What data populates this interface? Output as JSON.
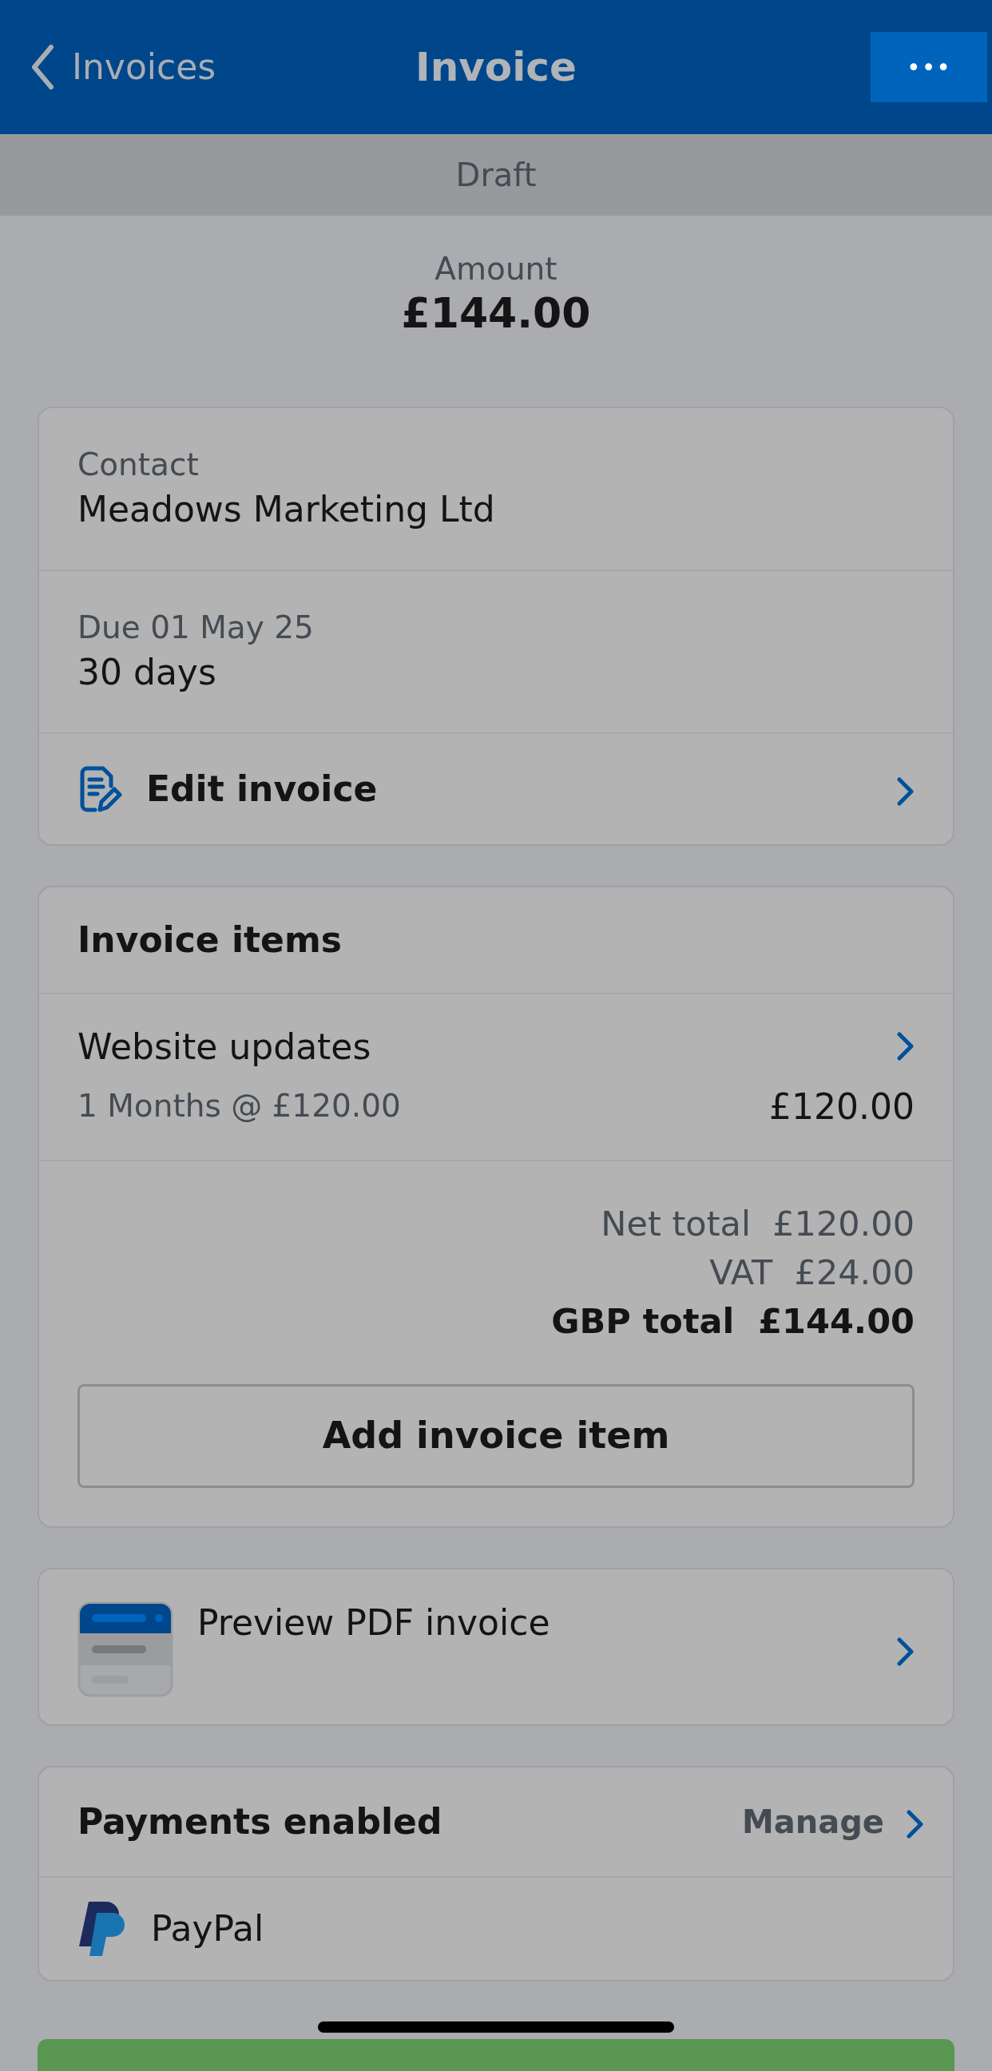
{
  "nav": {
    "back": "Invoices",
    "title": "Invoice",
    "more": "•••"
  },
  "status": "Draft",
  "amount": {
    "label": "Amount",
    "value": "£144.00"
  },
  "details": [
    {
      "label": "Contact",
      "value": "Meadows Marketing Ltd"
    },
    {
      "label": "Due 01 May 25",
      "value": "30 days"
    }
  ],
  "edit": {
    "label": "Edit invoice"
  },
  "items": {
    "title": "Invoice items",
    "rows": [
      {
        "name": "Website updates",
        "detail": "1 Months @ £120.00",
        "amount": "£120.00"
      }
    ],
    "totals": [
      {
        "label": "Net total",
        "value": "£120.00",
        "bold": false
      },
      {
        "label": "VAT",
        "value": "£24.00",
        "bold": false
      },
      {
        "label": "GBP total",
        "value": "£144.00",
        "bold": true
      }
    ],
    "add_button": "Add invoice item"
  },
  "preview": {
    "label": "Preview PDF invoice"
  },
  "payments": {
    "title": "Payments enabled",
    "manage": "Manage",
    "methods": [
      {
        "name": "PayPal"
      }
    ]
  }
}
